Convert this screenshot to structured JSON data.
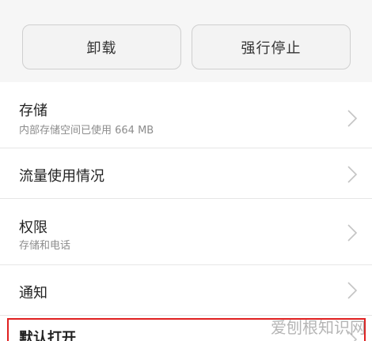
{
  "buttons": {
    "uninstall_label": "卸载",
    "force_stop_label": "强行停止"
  },
  "settings": [
    {
      "title": "存储",
      "subtitle": "内部存储空间已使用 664 MB"
    },
    {
      "title": "流量使用情况"
    },
    {
      "title": "权限",
      "subtitle": "存储和电话"
    },
    {
      "title": "通知"
    },
    {
      "title": "默认打开"
    }
  ],
  "watermark": "爱刨根知识网",
  "colors": {
    "highlight_border": "#e02020",
    "subtitle_text": "#8c8c8c",
    "chevron": "#c4c4c4"
  }
}
